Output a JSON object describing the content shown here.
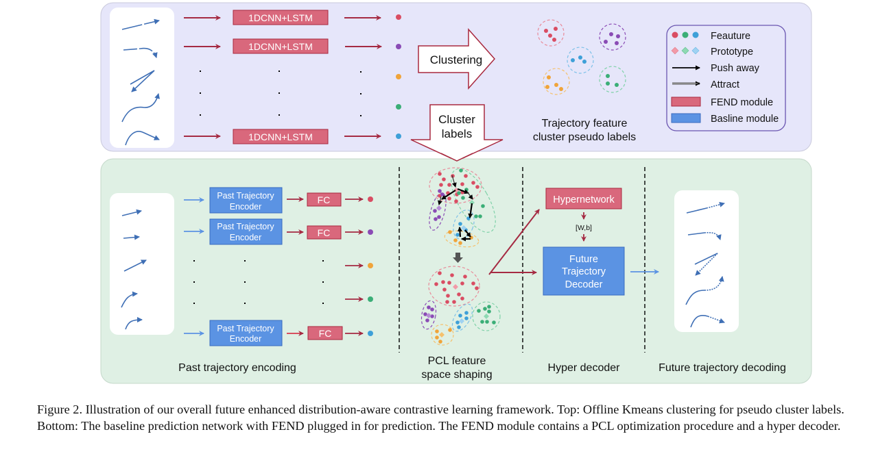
{
  "colors": {
    "top_panel_bg": "#e6e6fa",
    "bottom_panel_bg": "#dff0e4",
    "fend_fill": "#d9687c",
    "fend_stroke": "#a8283e",
    "baseline_fill": "#5b93e3",
    "baseline_stroke": "#3a6bbf",
    "arrow_red": "#a52a42",
    "arrow_blue": "#5b93e3",
    "trajectory": "#3f6fb5",
    "red": "#d94d63",
    "purple": "#8a4bb5",
    "orange": "#f0a43a",
    "green": "#3bae77",
    "blue": "#3ea0d8"
  },
  "top": {
    "encoder_label": "1DCNN+LSTM",
    "feature_colors": [
      "red",
      "purple",
      "orange",
      "green",
      "blue"
    ],
    "clustering_label": "Clustering",
    "cluster_labels_line1": "Cluster",
    "cluster_labels_line2": "labels",
    "clusters_caption_line1": "Trajectory feature",
    "clusters_caption_line2": "cluster pseudo labels",
    "legend": {
      "feature": "Feauture",
      "prototype": "Prototype",
      "push_away": "Push away",
      "attract": "Attract",
      "fend_module": "FEND module",
      "baseline_module": "Basline module"
    }
  },
  "bottom": {
    "encoder_line1": "Past Trajectory",
    "encoder_line2": "Encoder",
    "fc_label": "FC",
    "feature_colors": [
      "red",
      "purple",
      "orange",
      "green",
      "blue"
    ],
    "hypernetwork_label": "Hypernetwork",
    "weights_label": "[W,b]",
    "decoder_line1": "Future",
    "decoder_line2": "Trajectory",
    "decoder_line3": "Decoder",
    "sections": {
      "past_encoding": "Past trajectory encoding",
      "pcl_line1": "PCL feature",
      "pcl_line2": "space shaping",
      "hyper_decoder": "Hyper decoder",
      "future_decoding": "Future trajectory decoding"
    }
  },
  "caption": "Figure 2. Illustration of our overall future enhanced distribution-aware contrastive learning framework. Top: Offline Kmeans clustering for pseudo cluster labels. Bottom: The baseline prediction network with FEND plugged in for prediction. The FEND module contains a PCL optimization procedure and a hyper decoder."
}
